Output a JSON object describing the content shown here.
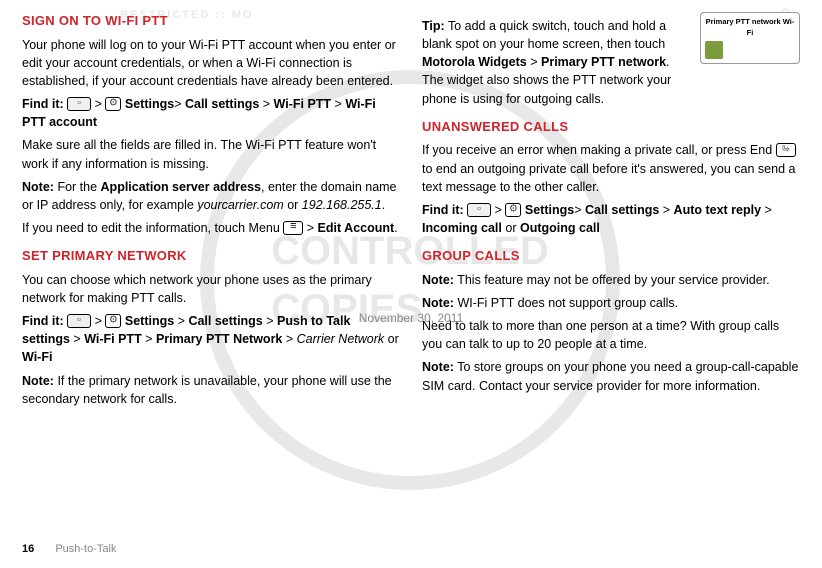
{
  "leftColumn": {
    "h1": "Sign on to Wi-Fi PTT",
    "p1": "Your phone will log on to your Wi-Fi PTT account when you enter or edit your account credentials, or when a Wi-Fi connection is established, if your account credentials have already been entered.",
    "findit1_a": "Find it:",
    "findit1_settings": "Settings",
    "findit1_b": "Call settings",
    "findit1_c": "Wi-Fi PTT",
    "findit1_d": "Wi-Fi PTT account",
    "p2": "Make sure all the fields are filled in. The Wi-Fi PTT feature won't work if any information is missing.",
    "note1_a": "Note:",
    "note1_b": "For the",
    "note1_c": "Application server address",
    "note1_d": ", enter the domain name or IP address only, for example",
    "note1_e": "yourcarrier.com",
    "note1_f": "or",
    "note1_g": "192.168.255.1",
    "p3_a": "If you need to edit the information, touch Menu",
    "p3_b": "Edit Account",
    "h2": "Set primary network",
    "p4": "You can choose which network your phone uses as the primary network for making PTT calls.",
    "findit2_a": "Find it:",
    "findit2_settings": "Settings",
    "findit2_b": "Call settings",
    "findit2_c": "Push to Talk settings",
    "findit2_d": "Wi-Fi PTT",
    "findit2_e": "Primary PTT Network",
    "findit2_f": "Carrier Network",
    "findit2_g": "or",
    "findit2_h": "Wi-Fi",
    "note2_a": "Note:",
    "note2_b": "If the primary network is unavailable, your phone will use the secondary network for calls."
  },
  "rightColumn": {
    "tip_a": "Tip:",
    "tip_b": "To add a quick switch, touch and hold a blank spot on your home screen, then touch",
    "tip_c": "Motorola Widgets",
    "tip_d": "Primary PTT network",
    "tip_e": ". The widget also shows the PTT network your phone is using for outgoing calls.",
    "widget_label": "Primary PTT network Wi-Fi",
    "h1": "Unanswered calls",
    "p1_a": "If you receive an error when making a private call, or press End",
    "p1_b": "to end an outgoing private call before it's answered, you can send a text message to the other caller.",
    "findit_a": "Find it:",
    "findit_settings": "Settings",
    "findit_b": "Call settings",
    "findit_c": "Auto text reply",
    "findit_d": "Incoming call",
    "findit_e": "or",
    "findit_f": "Outgoing call",
    "h2": "Group calls",
    "note1_a": "Note:",
    "note1_b": "This feature may not be offered by your service provider.",
    "note2_a": "Note:",
    "note2_b": "WI-Fi PTT does not support group calls.",
    "p2": "Need to talk to more than one person at a time? With group calls you can talk to up to 20 people at a time.",
    "note3_a": "Note:",
    "note3_b": "To store groups on your phone you need a group-call-capable SIM card. Contact your service provider for more information."
  },
  "date": "November 30, 2011",
  "footer": {
    "page": "16",
    "section": "Push-to-Talk"
  }
}
